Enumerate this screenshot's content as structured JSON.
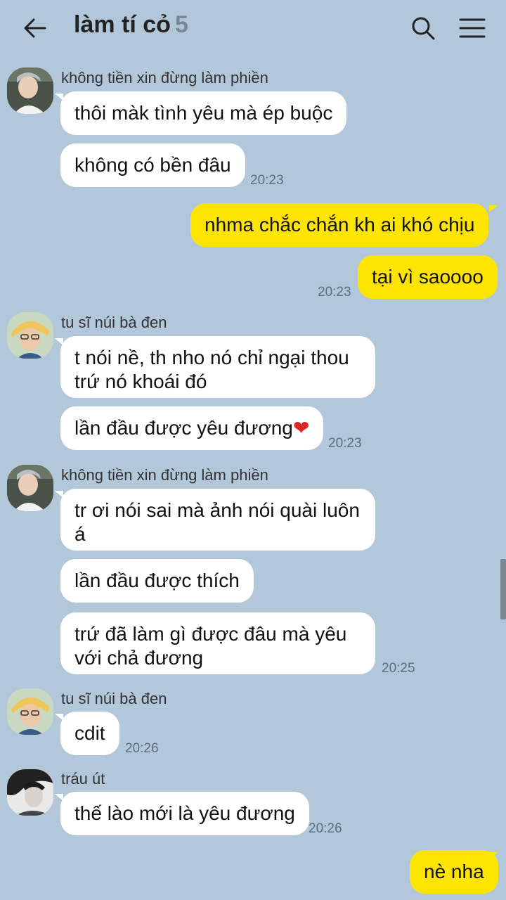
{
  "header": {
    "title": "làm tí cỏ",
    "member_count": "5"
  },
  "colors": {
    "background": "#b2c7da",
    "incoming_bubble": "#ffffff",
    "outgoing_bubble": "#fee500"
  },
  "icons": {
    "back": "arrow-left-icon",
    "search": "search-icon",
    "menu": "hamburger-menu-icon"
  },
  "messages": {
    "g1": {
      "sender": "không tiền xin đừng làm phiền",
      "m1": "thôi màk tình yêu mà ép buộc",
      "m2": "không có bền đâu",
      "time": "20:23"
    },
    "mine1": {
      "m1": "nhma chắc chắn kh ai khó chịu",
      "m2": "tại vì saoooo",
      "time": "20:23"
    },
    "g2": {
      "sender": "tu sĩ núi bà đen",
      "m1": "t nói nề, th nho nó chỉ ngại thou trứ nó khoái đó",
      "m2": "lần đầu được yêu đương",
      "m2_emoji": "❤",
      "time": "20:23"
    },
    "g3": {
      "sender": "không tiền xin đừng làm phiền",
      "m1": "tr ơi nói sai mà ảnh nói quài luôn á",
      "m2": "lần đầu được thích",
      "m3": "trứ đã làm gì được đâu mà yêu với chả đương",
      "time": "20:25"
    },
    "g4": {
      "sender": "tu sĩ núi bà đen",
      "m1": "cdit",
      "time": "20:26"
    },
    "g5": {
      "sender": "tráu út",
      "m1": "thế lào mới là yêu đương",
      "time": "20:26"
    },
    "mine2": {
      "m1": "nè nha"
    }
  }
}
